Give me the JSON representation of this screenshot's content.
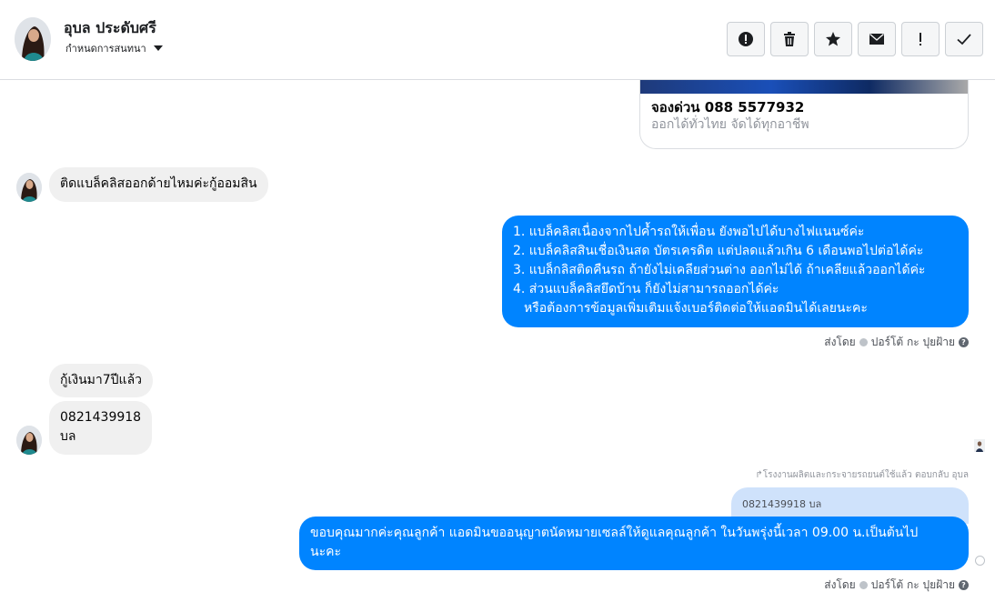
{
  "header": {
    "name": "อุบล ประดับศรี",
    "assign_label": "กำหนดการสนทนา",
    "actions": [
      "spam-icon",
      "trash-icon",
      "star-icon",
      "mail-icon",
      "exclamation-icon",
      "check-icon"
    ]
  },
  "card": {
    "title": "จองด่วน 088 5577932",
    "subtitle": "ออกได้ทั่วไทย จัดได้ทุกอาชีพ"
  },
  "messages": {
    "m1": "ติดแบล็คลิสออกด้ายไหมค่ะกู้ออมสิน",
    "m2": [
      "1. แบล็คลิสเนื่องจากไปค้ำรถให้เพื่อน ยังพอไปได้บางไฟแนนซ์ค่ะ",
      "2. แบล็คลิสสินเชื่อเงินสด บัตรเครดิต แต่ปลดแล้วเกิน 6 เดือนพอไปต่อได้ค่ะ",
      "3. แบล็กลิสติดคืนรถ ถ้ายังไม่เคลียส่วนต่าง ออกไม่ได้ ถ้าเคลียแล้วออกได้ค่ะ",
      "4. ส่วนแบล็คลิสยึดบ้าน ก็ยังไม่สามารถออกได้ค่ะ",
      "หรือต้องการข้อมูลเพิ่มเติมแจ้งเบอร์ติดต่อให้แอดมินได้เลยนะคะ"
    ],
    "sent_by_1": "ส่งโดย",
    "sender_1": "ปอร์โต้ กะ ปุยฝ้าย",
    "m3": "กู้เงินมา7ปีแล้ว",
    "m4_line1": "0821439918",
    "m4_line2": "บล",
    "reply_note": "โรงงานผลิตและกระจายรถยนต์ใช้แล้ว ตอบกลับ อุบล",
    "quoted": "0821439918 บล",
    "m5_line1": "ขอบคุณมากค่ะคุณลูกค้า แอดมินขออนุญาตนัดหมายเซลล์ให้ดูแลคุณลูกค้า ในวันพรุ่งนี้เวลา 09.00 น.เป็นต้นไป",
    "m5_line2": "นะคะ",
    "sent_by_2": "ส่งโดย",
    "sender_2": "ปอร์โต้ กะ ปุยฝ้าย",
    "help": "?"
  },
  "colors": {
    "outgoing": "#0084ff",
    "incoming": "#f0f0f0",
    "quoted": "#cfe2fb"
  }
}
